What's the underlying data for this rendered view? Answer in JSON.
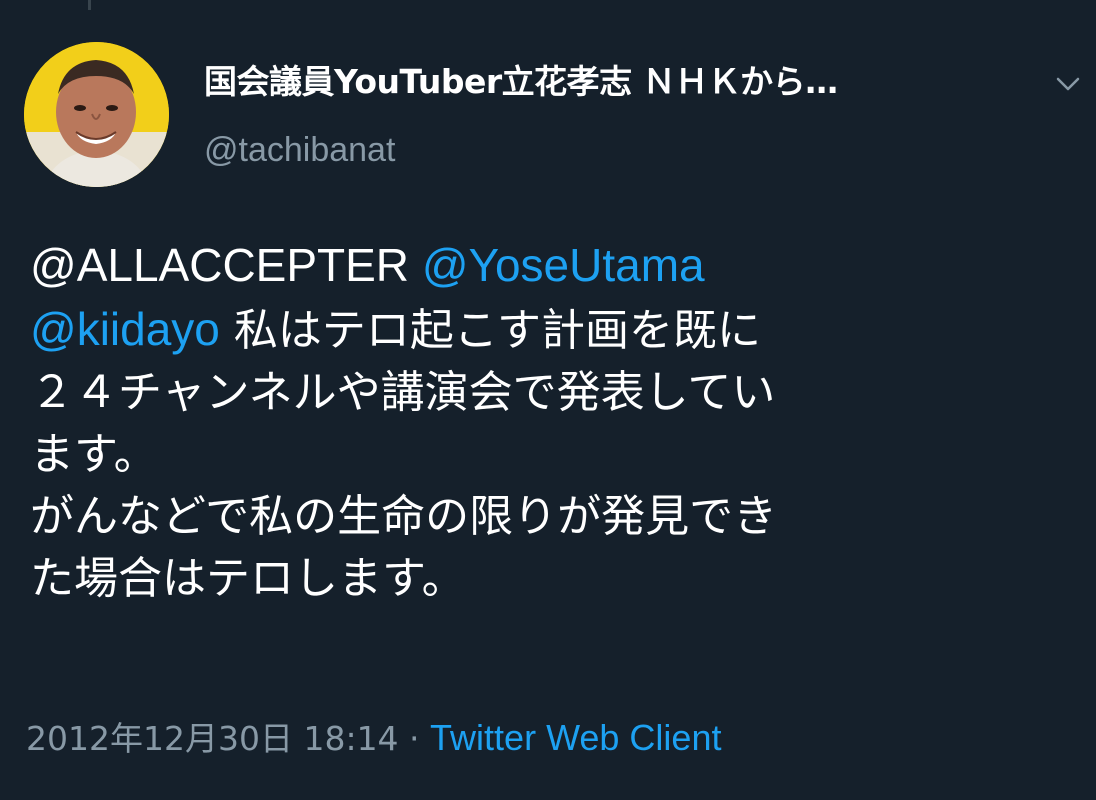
{
  "tweet": {
    "author": {
      "display_name": "国会議員YouTuber立花孝志 ＮＨＫから…",
      "handle": "@tachibanat",
      "avatar_icon": "profile-photo-avatar"
    },
    "menu_icon": "chevron-down-icon",
    "body": {
      "mention_1": "@ALLACCEPTER",
      "mention_2": "@YoseUtama",
      "mention_3": "@kiidayo",
      "line_2_text": " 私はテロ起こす計画を既に",
      "line_3_text": "２４チャンネルや講演会で発表してい",
      "line_4_text": "ます。",
      "line_5_text": "がんなどで私の生命の限りが発見でき",
      "line_6_text": "た場合はテロします。"
    },
    "meta": {
      "timestamp": "2012年12月30日 18:14",
      "separator": " · ",
      "client": "Twitter Web Client"
    }
  },
  "colors": {
    "background": "#15202b",
    "text": "#ffffff",
    "secondary": "#8899a6",
    "link": "#1da1f2"
  }
}
